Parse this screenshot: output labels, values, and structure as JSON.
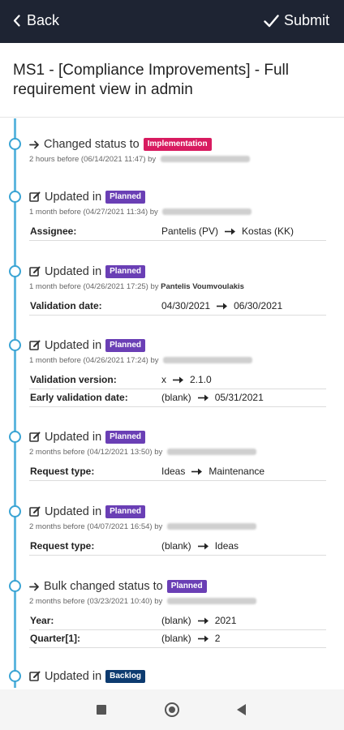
{
  "header": {
    "back_label": "Back",
    "submit_label": "Submit"
  },
  "page": {
    "title": "MS1 - [Compliance Improvements] - Full requirement view in admin"
  },
  "timeline": [
    {
      "action": "Changed status to",
      "badge": "Implementation",
      "meta_prefix": "2 hours before (06/14/2021 11:47) by",
      "author": "",
      "rows": []
    },
    {
      "action": "Updated in",
      "badge": "Planned",
      "meta_prefix": "1 month before (04/27/2021 11:34) by",
      "author": "",
      "rows": [
        {
          "label": "Assignee:",
          "from": "Pantelis (PV)",
          "to": "Kostas (KK)"
        }
      ]
    },
    {
      "action": "Updated in",
      "badge": "Planned",
      "meta_prefix": "1 month before (04/26/2021 17:25) by",
      "author": "Pantelis Voumvoulakis",
      "rows": [
        {
          "label": "Validation date:",
          "from": "04/30/2021",
          "to": "06/30/2021"
        }
      ]
    },
    {
      "action": "Updated in",
      "badge": "Planned",
      "meta_prefix": "1 month before (04/26/2021 17:24) by",
      "author": "",
      "rows": [
        {
          "label": "Validation version:",
          "from": "x",
          "to": "2.1.0"
        },
        {
          "label": "Early validation date:",
          "from": "(blank)",
          "to": "05/31/2021"
        }
      ]
    },
    {
      "action": "Updated in",
      "badge": "Planned",
      "meta_prefix": "2 months before (04/12/2021 13:50) by",
      "author": "",
      "rows": [
        {
          "label": "Request type:",
          "from": "Ideas",
          "to": "Maintenance"
        }
      ]
    },
    {
      "action": "Updated in",
      "badge": "Planned",
      "meta_prefix": "2 months before (04/07/2021 16:54) by",
      "author": "",
      "rows": [
        {
          "label": "Request type:",
          "from": "(blank)",
          "to": "Ideas"
        }
      ]
    },
    {
      "action": "Bulk changed status to",
      "badge": "Planned",
      "meta_prefix": "2 months before (03/23/2021 10:40) by",
      "author": "",
      "rows": [
        {
          "label": "Year:",
          "from": "(blank)",
          "to": "2021"
        },
        {
          "label": "Quarter[1]:",
          "from": "(blank)",
          "to": "2"
        }
      ]
    },
    {
      "action": "Updated in",
      "badge": "Backlog",
      "meta_prefix": "",
      "author": "",
      "rows": []
    }
  ],
  "colors": {
    "header_bg": "#1e2433",
    "timeline_line": "#5fb7de",
    "badge_implementation": "#d81b60",
    "badge_planned": "#6a3fb5",
    "badge_backlog": "#0d3b70"
  },
  "icons": {
    "back": "chevron-left-icon",
    "submit": "checkmark-icon",
    "status_change": "arrow-right-icon",
    "update": "edit-icon"
  }
}
